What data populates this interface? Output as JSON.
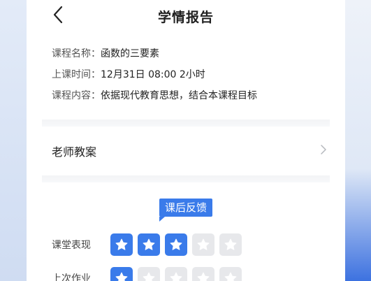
{
  "header": {
    "title": "学情报告"
  },
  "course": {
    "name_label": "课程名称：",
    "name_value": "函数的三要素",
    "time_label": "上课时间：",
    "time_value": "12月31日 08:00 2小时",
    "content_label": "课程内容：",
    "content_value": "依据现代教育思想，结合本课程目标"
  },
  "lesson_plan": {
    "label": "老师教案"
  },
  "feedback": {
    "tag": "课后反馈",
    "ratings": [
      {
        "label": "课堂表现",
        "score": 3,
        "max": 5
      },
      {
        "label": "上次作业",
        "score": 1,
        "max": 5
      }
    ]
  },
  "colors": {
    "accent": "#3a7bea",
    "star_off": "#e7e8eb"
  },
  "icons": {
    "back": "chevron-left-icon",
    "forward": "chevron-right-icon",
    "star": "star-icon"
  }
}
